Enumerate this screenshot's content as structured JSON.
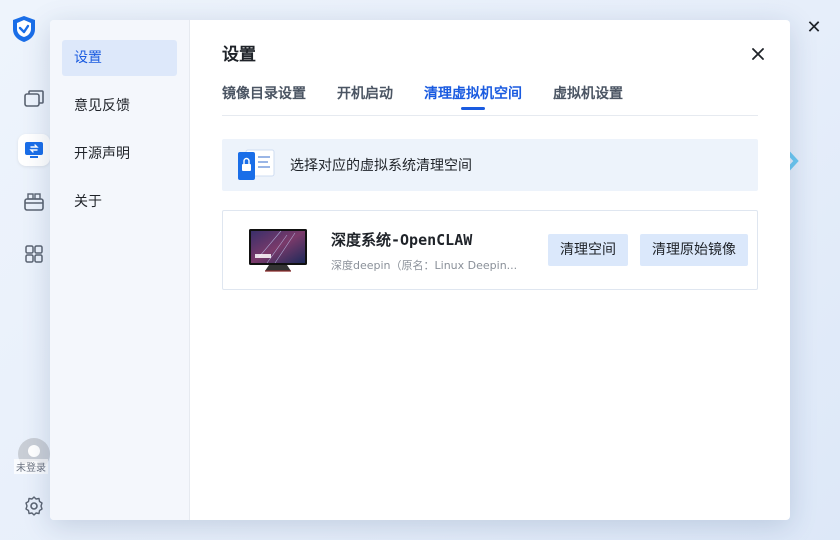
{
  "app": {
    "logo_icon": "shield-logo-icon",
    "rail_icons": [
      "windows-icon",
      "virtual-machine-icon",
      "toolbox-icon",
      "apps-grid-icon"
    ],
    "user_label": "未登录",
    "settings_icon": "gear-icon",
    "close_icon": "close-icon"
  },
  "dialog": {
    "title": "设置",
    "close_icon": "close-icon",
    "sidebar": {
      "items": [
        {
          "label": "设置",
          "active": true
        },
        {
          "label": "意见反馈",
          "active": false
        },
        {
          "label": "开源声明",
          "active": false
        },
        {
          "label": "关于",
          "active": false
        }
      ]
    },
    "tabs": [
      {
        "label": "镜像目录设置",
        "active": false
      },
      {
        "label": "开机启动",
        "active": false
      },
      {
        "label": "清理虚拟机空间",
        "active": true
      },
      {
        "label": "虚拟机设置",
        "active": false
      }
    ],
    "banner": {
      "icon": "secure-document-icon",
      "text": "选择对应的虚拟系统清理空间"
    },
    "vm": {
      "name": "深度系统-OpenCLAW",
      "description": "深度deepin（原名：Linux Deepin...",
      "thumbnail_icon": "monitor-thumbnail-icon",
      "clean_label": "清理空间",
      "clean_orig_label": "清理原始镜像"
    }
  },
  "colors": {
    "accent": "#1a5be0",
    "button_bg": "#dbe8fb",
    "sidebar_bg": "#f4f7fc",
    "banner_bg": "#edf3fb"
  }
}
